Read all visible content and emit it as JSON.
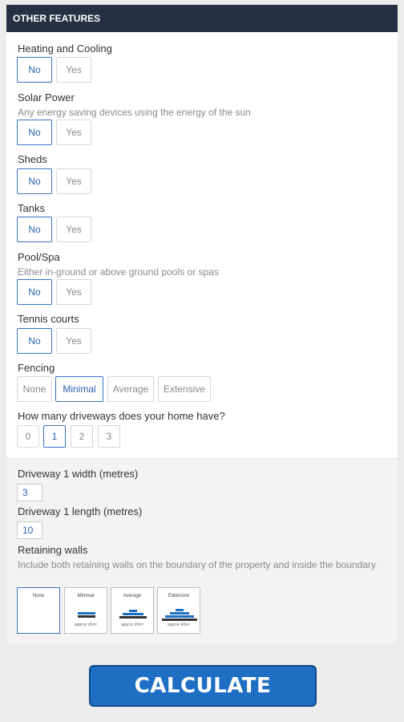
{
  "header": {
    "title": "OTHER FEATURES"
  },
  "questions": {
    "heating": {
      "label": "Heating and Cooling",
      "no": "No",
      "yes": "Yes"
    },
    "solar": {
      "label": "Solar Power",
      "desc": "Any energy saving devices using the energy of the sun",
      "no": "No",
      "yes": "Yes"
    },
    "sheds": {
      "label": "Sheds",
      "no": "No",
      "yes": "Yes"
    },
    "tanks": {
      "label": "Tanks",
      "no": "No",
      "yes": "Yes"
    },
    "pool": {
      "label": "Pool/Spa",
      "desc": "Either in-ground or above ground pools or spas",
      "no": "No",
      "yes": "Yes"
    },
    "tennis": {
      "label": "Tennis courts",
      "no": "No",
      "yes": "Yes"
    },
    "fencing": {
      "label": "Fencing",
      "options": [
        "None",
        "Minimal",
        "Average",
        "Extensive"
      ],
      "selected": "Minimal"
    },
    "driveways": {
      "label": "How many driveways does your home have?",
      "options": [
        "0",
        "1",
        "2",
        "3"
      ],
      "selected": "1"
    }
  },
  "driveway": {
    "width_label": "Driveway 1 width (metres)",
    "width_value": "3",
    "length_label": "Driveway 1 length (metres)",
    "length_value": "10"
  },
  "retaining": {
    "label": "Retaining walls",
    "desc": "Include both retaining walls on the boundary of the property and inside the boundary",
    "options": [
      {
        "title": "None",
        "approx": ""
      },
      {
        "title": "Minimal",
        "approx": "approx 10m²"
      },
      {
        "title": "Average",
        "approx": "approx 20m²"
      },
      {
        "title": "Extensive",
        "approx": "approx 40m²"
      }
    ],
    "selected": "None"
  },
  "calculate": {
    "label": "CALCULATE"
  },
  "colors": {
    "header_bg": "#253142",
    "accent": "#2d62b0",
    "calculate_bg": "#1e6fc4"
  }
}
